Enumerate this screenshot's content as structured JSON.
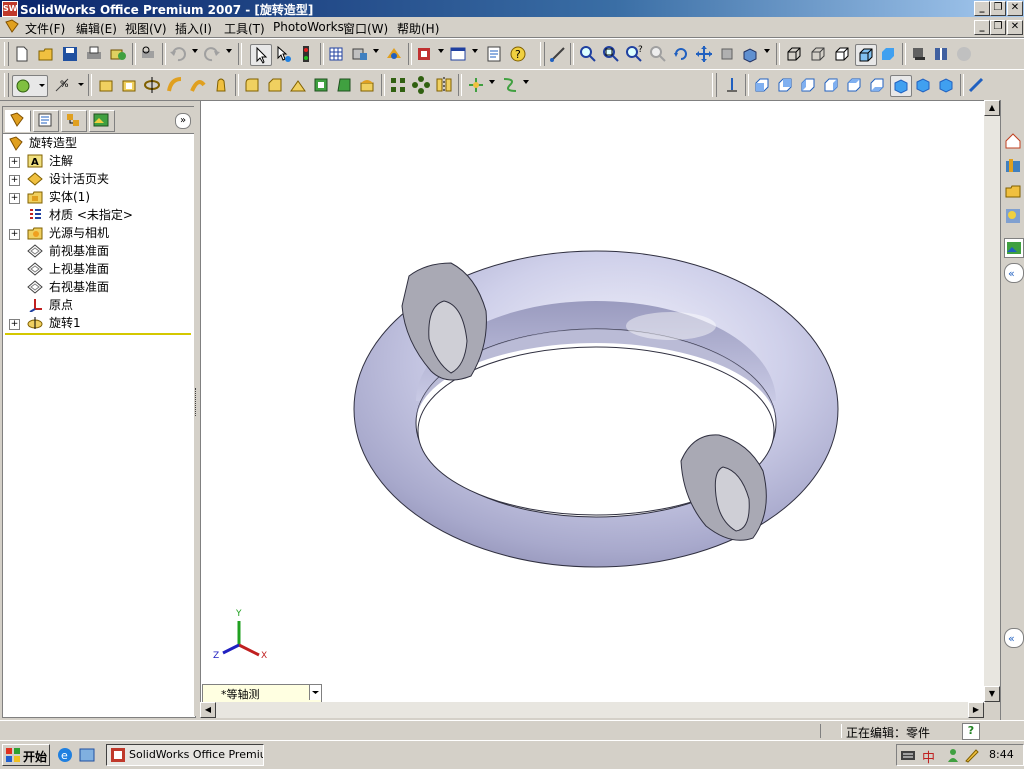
{
  "window": {
    "title": "SolidWorks Office Premium 2007 - [旋转造型]"
  },
  "menu": [
    "文件(F)",
    "编辑(E)",
    "视图(V)",
    "插入(I)",
    "工具(T)",
    "PhotoWorks",
    "窗口(W)",
    "帮助(H)"
  ],
  "tree": {
    "root": "旋转造型",
    "items": [
      {
        "label": "注解",
        "icon": "annotations-icon",
        "expandable": true
      },
      {
        "label": "设计活页夹",
        "icon": "design-binder-icon",
        "expandable": true
      },
      {
        "label": "实体(1)",
        "icon": "solid-bodies-icon",
        "expandable": true
      },
      {
        "label": "材质 <未指定>",
        "icon": "material-icon",
        "expandable": false
      },
      {
        "label": "光源与相机",
        "icon": "lights-cameras-icon",
        "expandable": true
      },
      {
        "label": "前视基准面",
        "icon": "plane-icon",
        "expandable": false
      },
      {
        "label": "上视基准面",
        "icon": "plane-icon",
        "expandable": false
      },
      {
        "label": "右视基准面",
        "icon": "plane-icon",
        "expandable": false
      },
      {
        "label": "原点",
        "icon": "origin-icon",
        "expandable": false
      },
      {
        "label": "旋转1",
        "icon": "revolve-feature-icon",
        "expandable": true
      }
    ]
  },
  "viewport": {
    "view_orientation": "*等轴测",
    "triad": {
      "x": "X",
      "y": "Y",
      "z": "Z"
    }
  },
  "status": {
    "editing": "正在编辑：零件",
    "help": "?"
  },
  "taskbar": {
    "start": "开始",
    "task_item": "SolidWorks Office Premiu...",
    "ime": "中",
    "clock": "8:44"
  },
  "colors": {
    "title_start": "#0a246a",
    "title_end": "#a6caf0",
    "part": "#c8c9e6"
  }
}
